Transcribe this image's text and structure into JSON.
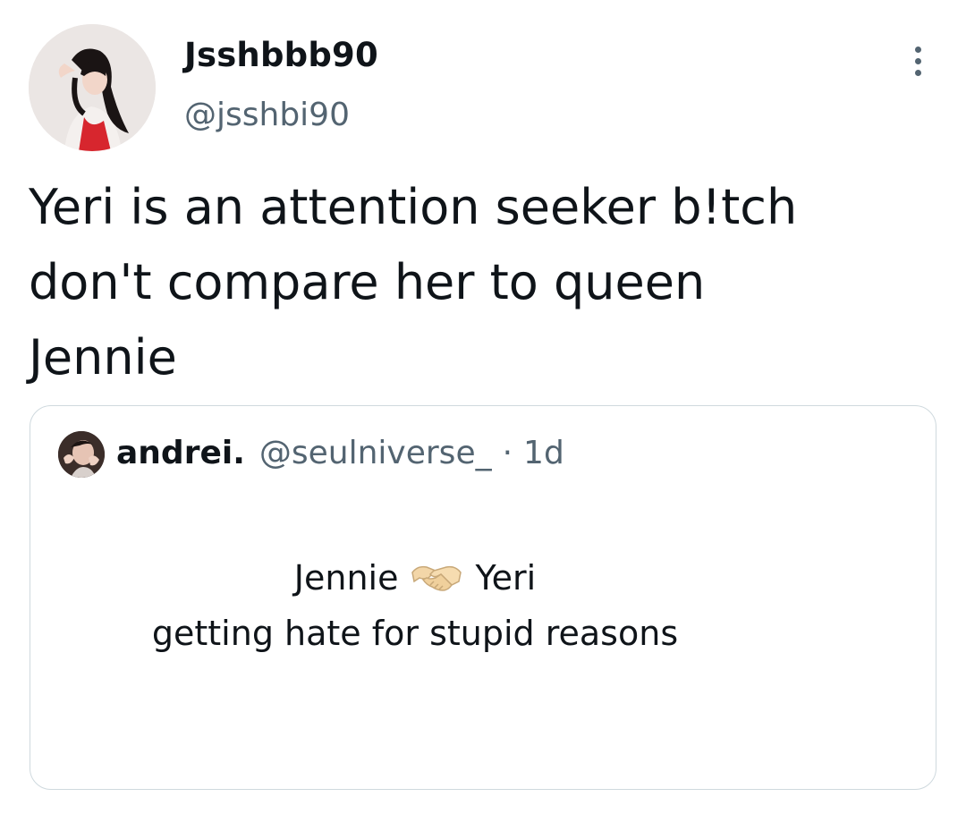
{
  "tweet": {
    "display_name": "Jsshbbb90",
    "handle": "@jsshbi90",
    "text_lines": [
      "Yeri is an attention seeker b!tch",
      "don't compare her to queen",
      "Jennie"
    ],
    "more_icon": "more-options-icon",
    "avatar_icon": "profile-photo"
  },
  "quote": {
    "display_name": "andrei.",
    "handle": "@seulniverse_",
    "separator": "·",
    "time": "1d",
    "line1_left": "Jennie",
    "line1_emoji": "handshake-icon",
    "line1_right": "Yeri",
    "line2": "getting hate for stupid reasons"
  },
  "colors": {
    "text_primary": "#0f1419",
    "text_secondary": "#536471",
    "border": "#cfd9de",
    "background": "#ffffff"
  }
}
